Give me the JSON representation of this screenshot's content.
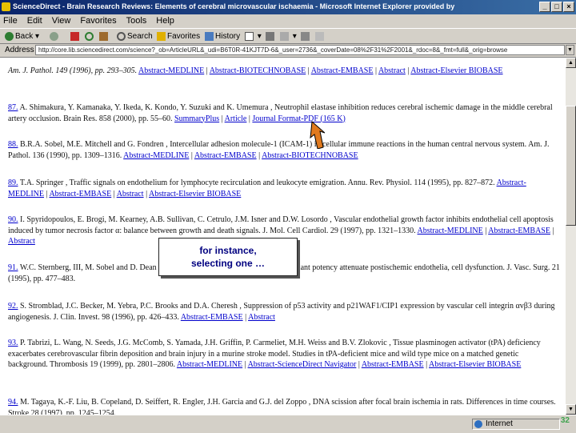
{
  "window": {
    "title": "ScienceDirect - Brain Research Reviews: Elements of cerebral microvascular ischaemia - Microsoft Internet Explorer provided by",
    "buttons": {
      "minimize": "_",
      "maximize": "□",
      "close": "×"
    }
  },
  "menu": [
    "File",
    "Edit",
    "View",
    "Favorites",
    "Tools",
    "Help"
  ],
  "toolbar": {
    "back": "Back",
    "search": "Search",
    "favorites": "Favorites",
    "history": "History"
  },
  "address": {
    "label": "Address",
    "url": "http://core.lib.sciencedirect.com/science?_ob=ArticleURL&_udi=B6T0R-41KJT7D-6&_user=2736&_coverDate=08%2F31%2F2001&_rdoc=8&_fmt=full&_orig=browse"
  },
  "refs": [
    {
      "top": "Am. J. Pathol. 149 (1996), pp. 293–305.",
      "links": [
        "Abstract-MEDLINE",
        "Abstract-BIOTECHNOBASE",
        "Abstract-EMBASE",
        "Abstract",
        "Abstract-Elsevier BIOBASE"
      ]
    },
    {
      "num": "87.",
      "text": "A. Shimakura, Y. Kamanaka, Y. Ikeda, K. Kondo, Y. Suzuki and K. Umemura , Neutrophil elastase inhibition reduces cerebral ischemic damage in the middle cerebral artery occlusion. Brain Res. 858 (2000), pp. 55–60.",
      "links": [
        "SummaryPlus",
        "Article",
        "Journal Format-PDF (165 K)"
      ]
    },
    {
      "num": "88.",
      "text": "B.R.A. Sobel, M.E. Mitchell and G. Fondren , Intercellular adhesion molecule-1 (ICAM-1) in cellular immune reactions in the human central nervous system. Am. J. Pathol. 136 (1990), pp. 1309–1316.",
      "links": [
        "Abstract-MEDLINE",
        "Abstract-EMBASE",
        "Abstract-BIOTECHNOBASE"
      ]
    },
    {
      "num": "89.",
      "text": "T.A. Springer , Traffic signals on endothelium for lymphocyte recirculation and leukocyte emigration. Annu. Rev. Physiol. 114 (1995), pp. 827–872.",
      "links": [
        "Abstract-MEDLINE",
        "Abstract-EMBASE",
        "Abstract",
        "Abstract-Elsevier BIOBASE"
      ]
    },
    {
      "num": "90.",
      "text": "I. Spyridopoulos, E. Brogi, M. Kearney, A.B. Sullivan, C. Cetrulo, J.M. Isner and D.W. Losordo , Vascular endothelial growth factor inhibits endothelial cell apoptosis induced by tumor necrosis factor α: balance between growth and death signals. J. Mol. Cell Cardiol. 29 (1997), pp. 1321–1330.",
      "links": [
        "Abstract-MEDLINE",
        "Abstract-EMBASE",
        "Abstract"
      ]
    },
    {
      "num": "91.",
      "text": "W.C. Sternberg, III, M. Sobel and D. Dean , Ischemia-reperfusion injury and anticoagulant potency attenuate postischemic endothelia, cell dysfunction. J. Vasc. Surg. 21 (1995), pp. 477–483.",
      "links": []
    },
    {
      "num": "92.",
      "text": "S. Stromblad, J.C. Becker, M. Yebra, P.C. Brooks and D.A. Cheresh , Suppression of p53 activity and p21WAF1/CIP1 expression by vascular cell integrin αvβ3 during angiogenesis. J. Clin. Invest. 98 (1996), pp. 426–433.",
      "links": [
        "Abstract-EMBASE",
        "Abstract"
      ]
    },
    {
      "num": "93.",
      "text": "P. Tabrizi, L. Wang, N. Seeds, J.G. McComb, S. Yamada, J.H. Griffin, P. Carmeliet, M.H. Weiss and B.V. Zlokovic , Tissue plasminogen activator (tPA) deficiency exacerbates cerebrovascular fibrin deposition and brain injury in a murine stroke model. Studies in tPA-deficient mice and wild type mice on a matched genetic background. Thrombosis 19 (1999), pp. 2801–2806.",
      "links": [
        "Abstract-MEDLINE",
        "Abstract-ScienceDirect Navigator",
        "Abstract-EMBASE",
        "Abstract-Elsevier BIOBASE"
      ]
    },
    {
      "num": "94.",
      "text": "M. Tagaya, K.-F. Liu, B. Copeland, D. Seiffert, R. Engler, J.H. Garcia and G.J. del Zoppo , DNA scission after focal brain ischemia in rats. Differences in time courses. Stroke 28 (1997), pp. 1245–1254.",
      "links": []
    }
  ],
  "callout": {
    "line1": "for instance,",
    "line2": "selecting one …"
  },
  "status": {
    "zone": "Internet"
  },
  "page_number": "32",
  "colors": {
    "link": "#0000cc",
    "titlebar": "#0a246a",
    "page_number": "#3fa34d"
  }
}
